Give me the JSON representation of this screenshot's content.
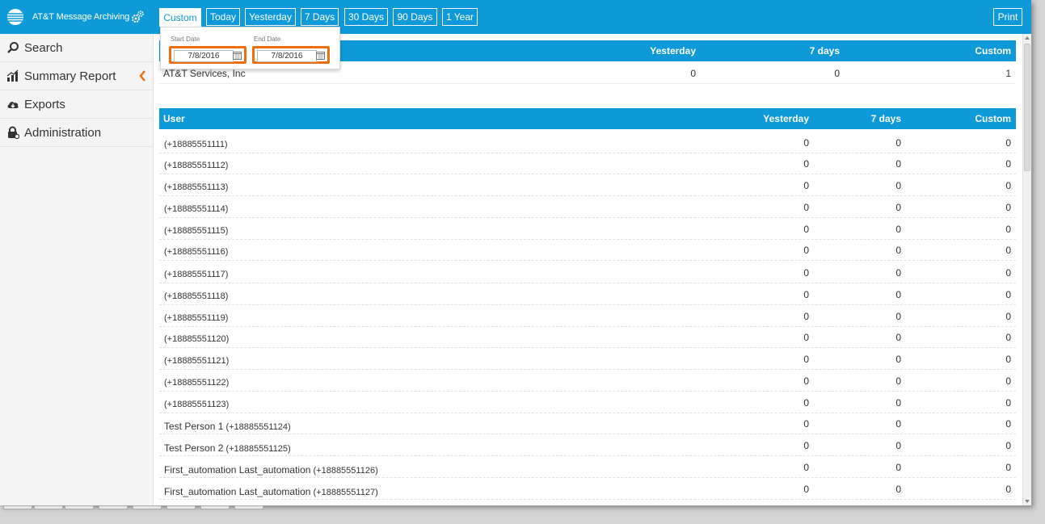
{
  "app": {
    "title": "AT&T Message Archiving"
  },
  "topbar": {
    "ranges": [
      "Custom",
      "Today",
      "Yesterday",
      "7 Days",
      "30 Days",
      "90 Days",
      "1 Year"
    ],
    "active_range": "Custom",
    "print_label": "Print"
  },
  "sidebar": {
    "items": [
      {
        "label": "Search",
        "icon": "search-icon"
      },
      {
        "label": "Summary Report",
        "icon": "bar-chart-icon"
      },
      {
        "label": "Exports",
        "icon": "cloud-download-icon"
      },
      {
        "label": "Administration",
        "icon": "lock-icon"
      }
    ]
  },
  "date_popup": {
    "start_label": "Start Date",
    "start_value": "7/8/2016",
    "end_label": "End Date",
    "end_value": "7/8/2016"
  },
  "account_table": {
    "columns": [
      "Yesterday",
      "7 days",
      "Custom"
    ],
    "rows": [
      {
        "name": "AT&T Services, Inc",
        "yesterday": "0",
        "seven_days": "0",
        "custom": "1"
      }
    ]
  },
  "user_table": {
    "columns": [
      "User",
      "Yesterday",
      "7 days",
      "Custom"
    ],
    "rows": [
      {
        "name": "",
        "phone": "(+18885551111)",
        "yesterday": "0",
        "seven_days": "0",
        "custom": "0"
      },
      {
        "name": "",
        "phone": "(+18885551112)",
        "yesterday": "0",
        "seven_days": "0",
        "custom": "0"
      },
      {
        "name": "",
        "phone": "(+18885551113)",
        "yesterday": "0",
        "seven_days": "0",
        "custom": "0"
      },
      {
        "name": "",
        "phone": "(+18885551114)",
        "yesterday": "0",
        "seven_days": "0",
        "custom": "0"
      },
      {
        "name": "",
        "phone": "(+18885551115)",
        "yesterday": "0",
        "seven_days": "0",
        "custom": "0"
      },
      {
        "name": "",
        "phone": "(+18885551116)",
        "yesterday": "0",
        "seven_days": "0",
        "custom": "0"
      },
      {
        "name": "",
        "phone": "(+18885551117)",
        "yesterday": "0",
        "seven_days": "0",
        "custom": "0"
      },
      {
        "name": "",
        "phone": "(+18885551118)",
        "yesterday": "0",
        "seven_days": "0",
        "custom": "0"
      },
      {
        "name": "",
        "phone": "(+18885551119)",
        "yesterday": "0",
        "seven_days": "0",
        "custom": "0"
      },
      {
        "name": "",
        "phone": "(+18885551120)",
        "yesterday": "0",
        "seven_days": "0",
        "custom": "0"
      },
      {
        "name": "",
        "phone": "(+18885551121)",
        "yesterday": "0",
        "seven_days": "0",
        "custom": "0"
      },
      {
        "name": "",
        "phone": "(+18885551122)",
        "yesterday": "0",
        "seven_days": "0",
        "custom": "0"
      },
      {
        "name": "",
        "phone": "(+18885551123)",
        "yesterday": "0",
        "seven_days": "0",
        "custom": "0"
      },
      {
        "name": "Test Person 1",
        "phone": "(+18885551124)",
        "yesterday": "0",
        "seven_days": "0",
        "custom": "0"
      },
      {
        "name": "Test Person 2",
        "phone": "(+18885551125)",
        "yesterday": "0",
        "seven_days": "0",
        "custom": "0"
      },
      {
        "name": "First_automation Last_automation",
        "phone": "(+18885551126)",
        "yesterday": "0",
        "seven_days": "0",
        "custom": "0"
      },
      {
        "name": "First_automation Last_automation",
        "phone": "(+18885551127)",
        "yesterday": "0",
        "seven_days": "0",
        "custom": "0"
      }
    ]
  },
  "colors": {
    "brand_blue": "#0e9ad8",
    "highlight_orange": "#ee6d10",
    "sidebar_bg": "#f4f4f4"
  }
}
